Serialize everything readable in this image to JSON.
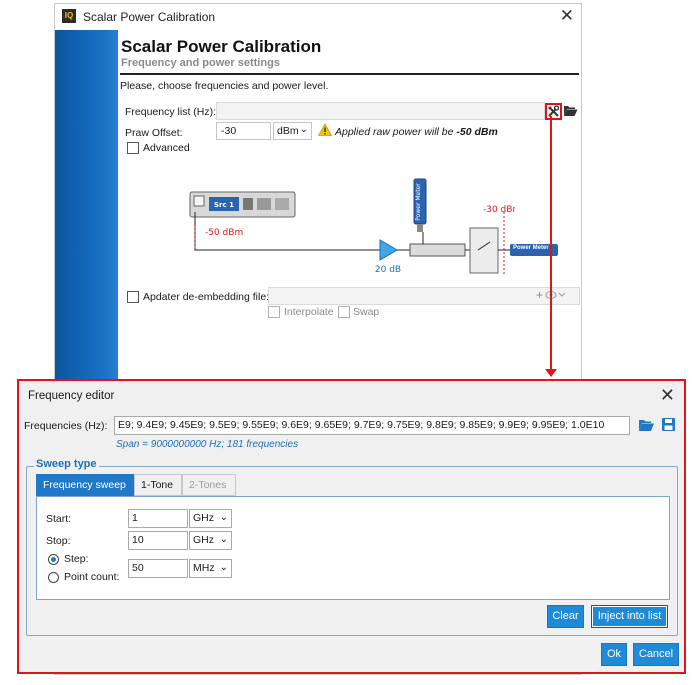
{
  "main_window": {
    "title": "Scalar Power Calibration",
    "logo_text": "IQ",
    "close_glyph": "✕",
    "header_title": "Scalar Power Calibration",
    "header_subtitle": "Frequency and power settings",
    "instruction": "Please, choose frequencies and power level.",
    "frequency_list_label": "Frequency list (Hz):",
    "frequency_list_value": "",
    "praw_label": "Praw Offset:",
    "praw_value": "-30",
    "praw_unit": "dBm",
    "applied_prefix": "Applied raw power will be",
    "applied_value": "-50 dBm",
    "advanced_label": "Advanced",
    "adapter_label": "Apdater de-embedding file:",
    "adapter_value": "",
    "interpolate_label": "Interpolate",
    "swap_label": "Swap",
    "diagram": {
      "source_label": "Src 1",
      "power_meter_label": "Power Meter",
      "level_source": "-50 dBm",
      "level_output": "-30 dBm",
      "amp_gain": "20 dB"
    },
    "icons": {
      "tools": "tools-icon",
      "folder": "folder-open-icon",
      "warning": "warning-icon",
      "eye": "eye-icon"
    }
  },
  "frequency_editor": {
    "title": "Frequency editor",
    "close_glyph": "✕",
    "frequencies_label": "Frequencies (Hz):",
    "frequencies_value": "E9; 9.4E9; 9.45E9; 9.5E9; 9.55E9; 9.6E9; 9.65E9; 9.7E9; 9.75E9; 9.8E9; 9.85E9; 9.9E9; 9.95E9; 1.0E10",
    "span_info": "Span = 9000000000 Hz; 181 frequencies",
    "sweep_type_legend": "Sweep type",
    "tabs": [
      {
        "label": "Frequency sweep",
        "state": "active"
      },
      {
        "label": "1-Tone",
        "state": "normal"
      },
      {
        "label": "2-Tones",
        "state": "disabled"
      }
    ],
    "start_label": "Start:",
    "start_value": "1",
    "start_unit": "GHz",
    "stop_label": "Stop:",
    "stop_value": "10",
    "stop_unit": "GHz",
    "step_label": "Step:",
    "point_count_label": "Point count:",
    "step_value": "50",
    "step_unit": "MHz",
    "step_mode": "step",
    "clear_button": "Clear",
    "inject_button": "Inject into list",
    "ok_button": "Ok",
    "cancel_button": "Cancel"
  },
  "colors": {
    "accent_blue": "#1f8ad6",
    "annotation_red": "#e0151b",
    "banner_blue": "#0b55a0"
  }
}
